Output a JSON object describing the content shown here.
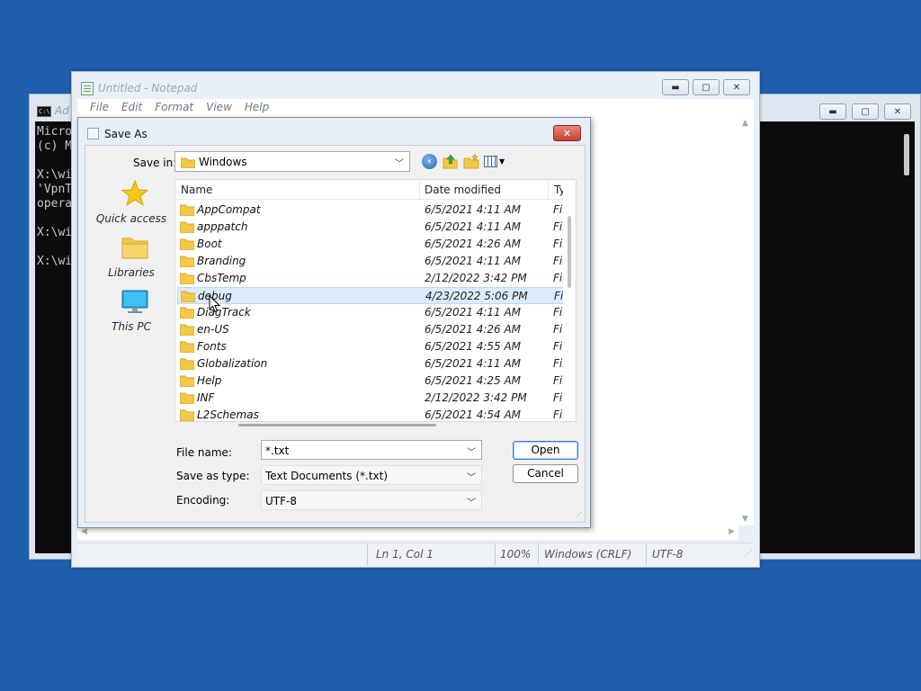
{
  "console": {
    "title": "Ad",
    "icon": "C:\\",
    "lines": [
      "Micro",
      "(c) M",
      "",
      "X:\\wi",
      "'VpnT",
      "opera",
      "",
      "X:\\wi",
      "",
      "X:\\wi"
    ]
  },
  "notepad": {
    "title": "Untitled - Notepad",
    "menu": [
      "File",
      "Edit",
      "Format",
      "View",
      "Help"
    ],
    "status": {
      "position": "Ln 1, Col 1",
      "zoom": "100%",
      "line_ending": "Windows (CRLF)",
      "encoding": "UTF-8"
    }
  },
  "dialog": {
    "title": "Save As",
    "close_label": "✕",
    "save_in_label": "Save in:",
    "save_in_value": "Windows",
    "places": [
      "Quick access",
      "Libraries",
      "This PC"
    ],
    "columns": [
      "Name",
      "Date modified",
      "Ty"
    ],
    "files": [
      {
        "name": "AppCompat",
        "date": "6/5/2021 4:11 AM",
        "type": "Fil"
      },
      {
        "name": "apppatch",
        "date": "6/5/2021 4:11 AM",
        "type": "Fil"
      },
      {
        "name": "Boot",
        "date": "6/5/2021 4:26 AM",
        "type": "Fil"
      },
      {
        "name": "Branding",
        "date": "6/5/2021 4:11 AM",
        "type": "Fil"
      },
      {
        "name": "CbsTemp",
        "date": "2/12/2022 3:42 PM",
        "type": "Fil"
      },
      {
        "name": "debug",
        "date": "4/23/2022 5:06 PM",
        "type": "Fil"
      },
      {
        "name": "DiagTrack",
        "date": "6/5/2021 4:11 AM",
        "type": "Fil"
      },
      {
        "name": "en-US",
        "date": "6/5/2021 4:26 AM",
        "type": "Fil"
      },
      {
        "name": "Fonts",
        "date": "6/5/2021 4:55 AM",
        "type": "Fil"
      },
      {
        "name": "Globalization",
        "date": "6/5/2021 4:11 AM",
        "type": "Fil"
      },
      {
        "name": "Help",
        "date": "6/5/2021 4:25 AM",
        "type": "Fil"
      },
      {
        "name": "INF",
        "date": "2/12/2022 3:42 PM",
        "type": "Fil"
      },
      {
        "name": "L2Schemas",
        "date": "6/5/2021 4:54 AM",
        "type": "Fil"
      }
    ],
    "selected_file": "debug",
    "file_name_label": "File name:",
    "file_name_value": "*.txt",
    "save_as_type_label": "Save as type:",
    "save_as_type_value": "Text Documents (*.txt)",
    "encoding_label": "Encoding:",
    "encoding_value": "UTF-8",
    "open_button": "Open",
    "cancel_button": "Cancel"
  },
  "colors": {
    "desktop": "#1f5ead",
    "selection": "#dcebfb",
    "folder": "#f4c94a",
    "close_button": "#c9402f"
  }
}
